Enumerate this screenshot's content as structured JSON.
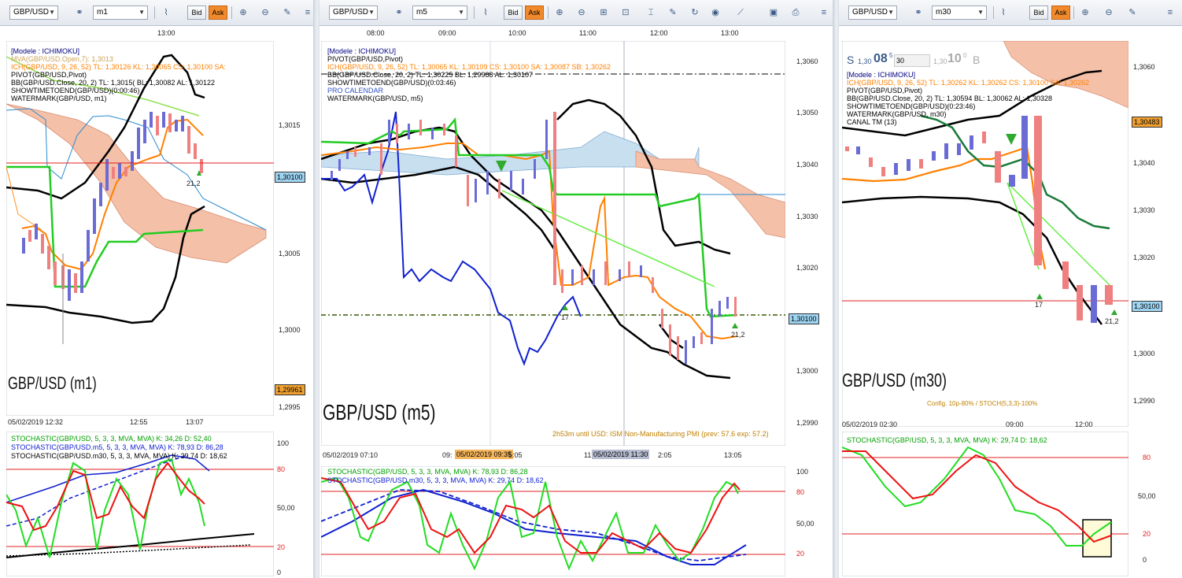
{
  "colors": {
    "bull": "#6b6bd6",
    "bear": "#f08080",
    "ichi": "#ff8000",
    "kijun": "#00c000",
    "bb": "#000000",
    "stoch_k": "#22dd22",
    "stoch_d": "#ee1111",
    "stoch_m5": "#1020d0",
    "cloud": "#f4c0a8",
    "cloud_bull": "#c8dff0",
    "current": "#e02020",
    "pivot_s": "#3a5a00"
  },
  "panels": [
    {
      "toolbar": {
        "symbol": "GBP/USD",
        "timeframe": "m1",
        "bid": "Bid",
        "ask": "Ask",
        "icons": [
          "link-icon",
          "chart-type-icon",
          "cursor-icon",
          "zoom-in-icon",
          "zoom-out-icon",
          "pin-icon"
        ]
      },
      "legend": [
        {
          "text": "[Modele : ICHIMOKU]",
          "color": "#000080"
        },
        {
          "text": "MVA(GBP/USD.Open,7): 1,3013",
          "color": "#cda35a"
        },
        {
          "text": "ICH(GBP/USD, 9, 26, 52)  TL: 1,30126  KL: 1,30065  CS: 1,30100  SA:",
          "color": "#ff8000"
        },
        {
          "text": "PIVOT(GBP/USD,Pivot)",
          "color": "#000"
        },
        {
          "text": "BB(GBP/USD.Close, 20, 2)  TL: 1,3015(  BL: 1,30082  AL: 1,30122",
          "color": "#000"
        },
        {
          "text": "SHOWTIMETOEND(GBP/USD)(0:00:46)",
          "color": "#000"
        },
        {
          "text": "WATERMARK(GBP/USD, m1)",
          "color": "#000"
        }
      ],
      "time_top": [
        "13:00"
      ],
      "time_bottom": [
        "05/02/2019 12:32",
        "12:55",
        "13:07"
      ],
      "price_axis": [
        "1,3015",
        "1,30100",
        "1,3005",
        "1,3000",
        "1,29961",
        "1,2995"
      ],
      "current_price": "1,30100",
      "low_marker": "1,29961",
      "arrow_label": "21,2",
      "watermark": "GBP/USD (m1)",
      "stoch_legend": [
        {
          "text": "STOCHASTIC(GBP/USD, 5, 3, 3, MVA, MVA)  K: 34,26  D: 52,40",
          "color": "#00a000"
        },
        {
          "text": "STOCHASTIC(GBP/USD.m5, 5, 3, 3, MVA, MVA)  K: 78,93  D: 86,28",
          "color": "#1020d0"
        },
        {
          "text": "STOCHASTIC(GBP/USD.m30, 5, 3, 3, MVA, MVA)  K: 29,74  D: 18,62",
          "color": "#000"
        }
      ],
      "stoch_axis": [
        "100",
        "80",
        "50,00",
        "20",
        "0"
      ]
    },
    {
      "toolbar": {
        "symbol": "GBP/USD",
        "timeframe": "m5",
        "bid": "Bid",
        "ask": "Ask",
        "icons": [
          "link-icon",
          "chart-type-icon",
          "cursor-icon",
          "zoom-in-icon",
          "zoom-out-icon",
          "zoom-fit-icon",
          "zoom-box-icon",
          "level-icon",
          "draw-icon",
          "refresh-icon",
          "globe-icon",
          "ruler-icon",
          "image-icon",
          "print-icon"
        ]
      },
      "legend": [
        {
          "text": "[Modele : ICHIMOKU]",
          "color": "#000080"
        },
        {
          "text": "PIVOT(GBP/USD,Pivot)",
          "color": "#000"
        },
        {
          "text": "ICH(GBP/USD, 9, 26, 52)  TL: 1,30065  KL: 1,30109  CS: 1,30100  SA: 1,30087  SB: 1,30262",
          "color": "#ff8000"
        },
        {
          "text": "BB(GBP/USD.Close, 20, 2)  TL: 1,30225  BL: 1,29988  AL: 1,30107",
          "color": "#000"
        },
        {
          "text": "SHOWTIMETOEND(GBP/USD)(0:03:46)",
          "color": "#000"
        },
        {
          "text": "PRO CALENDAR",
          "color": "#3050c0"
        },
        {
          "text": "WATERMARK(GBP/USD, m5)",
          "color": "#000"
        }
      ],
      "time_top": [
        "08:00",
        "09:00",
        "10:00",
        "11:00",
        "12:00",
        "13:00"
      ],
      "time_bottom": [
        "05/02/2019 07:10",
        "09:",
        "05/02/2019 09:35",
        "5:05",
        "11:",
        "05/02/2019 11:30",
        "2:05",
        "13:05"
      ],
      "price_axis": [
        "1,3060",
        "1,3050",
        "1,3040",
        "1,3030",
        "1,3020",
        "1,30100",
        "1,3000",
        "1,2990"
      ],
      "current_price": "1,30100",
      "arrow_label": "21,2",
      "low_label": "17",
      "watermark": "GBP/USD (m5)",
      "calendar_note": "2h53m until USD: ISM Non-Manufacturing PMI (prev: 57.6 exp: 57.2)",
      "stoch_legend": [
        {
          "text": "STOCHASTIC(GBP/USD, 5, 3, 3, MVA, MVA)  K: 78,93  D: 86,28",
          "color": "#00a000"
        },
        {
          "text": "STOCHASTIC(GBP/USD.m30, 5, 3, 3, MVA, MVA)  K: 29,74  D: 18,62",
          "color": "#1020d0"
        }
      ],
      "stoch_axis": [
        "100",
        "80",
        "50,00",
        "20"
      ]
    },
    {
      "toolbar": {
        "symbol": "GBP/USD",
        "timeframe": "m30",
        "bid": "Bid",
        "ask": "Ask",
        "icons": [
          "link-icon",
          "chart-type-icon",
          "cursor-icon",
          "zoom-in-icon",
          "zoom-out-icon",
          "pin-icon"
        ]
      },
      "quote": {
        "sell_big": "08",
        "sell_small": "1,30",
        "sell_sup": "5",
        "mid": "30",
        "buy_big": "10",
        "buy_small": "1,30",
        "buy_sup": "0",
        "s": "S",
        "b": "B"
      },
      "legend": [
        {
          "text": "[Modele : ICHIMOKU]",
          "color": "#000080"
        },
        {
          "text": "ICH(GBP/USD, 9, 26, 52)  TL: 1,30262  KL: 1,30262  CS: 1,30100  SA: 1,30262",
          "color": "#ff8000"
        },
        {
          "text": "PIVOT(GBP/USD,Pivot)",
          "color": "#000"
        },
        {
          "text": "BB(GBP/USD.Close, 20, 2)  TL: 1,30594  BL: 1,30062  AL: 1,30328",
          "color": "#000"
        },
        {
          "text": "SHOWTIMETOEND(GBP/USD)(0:23:46)",
          "color": "#000"
        },
        {
          "text": "WATERMARK(GBP/USD, m30)",
          "color": "#000"
        },
        {
          "text": "CANAL TM (13)",
          "color": "#000"
        }
      ],
      "time_bottom": [
        "05/02/2019 02:30",
        "09:00",
        "12:00"
      ],
      "price_axis": [
        "1,3060",
        "1,30483",
        "1,3040",
        "1,3030",
        "1,3020",
        "1,30100",
        "1,3000",
        "1,2990"
      ],
      "current_price": "1,30100",
      "high_marker": "1,30483",
      "arrow_label": "21,2",
      "low_label": "17",
      "watermark": "GBP/USD (m30)",
      "config_note": "Config. 10p-80% / STOCH(5,3,3)-100%",
      "stoch_legend": [
        {
          "text": "STOCHASTIC(GBP/USD, 5, 3, 3, MVA, MVA)  K: 29,74  D: 18,62",
          "color": "#00a000"
        }
      ],
      "stoch_axis": [
        "80",
        "50,00",
        "20",
        "0"
      ]
    }
  ]
}
